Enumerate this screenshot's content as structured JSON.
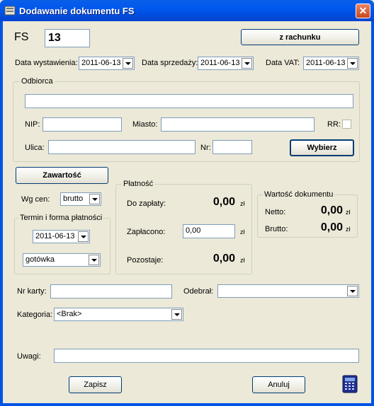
{
  "window": {
    "title": "Dodawanie dokumentu FS",
    "close_glyph": "✕"
  },
  "header": {
    "doc_type_label": "FS",
    "doc_number": "13",
    "from_bill_button": "z rachunku"
  },
  "dates": {
    "issue_label": "Data wystawienia:",
    "issue_value": "2011-06-13",
    "sale_label": "Data sprzedaży:",
    "sale_value": "2011-06-13",
    "vat_label": "Data VAT:",
    "vat_value": "2011-06-13"
  },
  "recipient": {
    "legend": "Odbiorca",
    "name_value": "",
    "nip_label": "NIP:",
    "nip_value": "",
    "city_label": "Miasto:",
    "city_value": "",
    "rr_label": "RR:",
    "street_label": "Ulica:",
    "street_value": "",
    "nr_label": "Nr:",
    "nr_value": "",
    "choose_button": "Wybierz"
  },
  "content": {
    "content_button": "Zawartość",
    "price_label": "Wg cen:",
    "price_value": "brutto",
    "terms_legend": "Termin i forma płatności",
    "term_date": "2011-06-13",
    "payment_method": "gotówka"
  },
  "payment": {
    "legend": "Płatność",
    "to_pay_label": "Do zapłaty:",
    "to_pay_value": "0,00",
    "paid_label": "Zapłacono:",
    "paid_value": "0,00",
    "remaining_label": "Pozostaje:",
    "remaining_value": "0,00",
    "currency": "zł"
  },
  "doc_value": {
    "legend": "Wartość dokumentu",
    "net_label": "Netto:",
    "net_value": "0,00",
    "gross_label": "Brutto:",
    "gross_value": "0,00",
    "currency": "zł"
  },
  "extra": {
    "card_label": "Nr karty:",
    "card_value": "",
    "received_label": "Odebrał:",
    "received_value": "",
    "category_label": "Kategoria:",
    "category_value": "<Brak>",
    "notes_label": "Uwagi:",
    "notes_value": ""
  },
  "footer": {
    "save_button": "Zapisz",
    "cancel_button": "Anuluj"
  },
  "icons": {
    "title_icon": "app-window-icon",
    "calculator": "calculator-icon"
  }
}
